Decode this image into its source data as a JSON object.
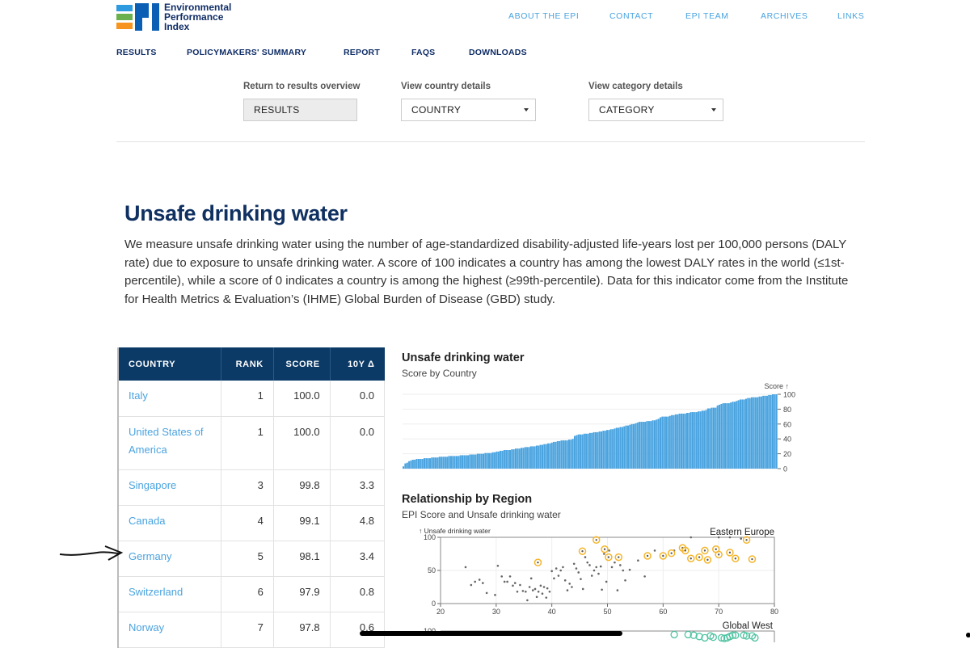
{
  "brand": {
    "line1": "Environmental",
    "line2": "Performance",
    "line3": "Index",
    "colors": {
      "blue_light": "#2e9be0",
      "green": "#6ab04c",
      "orange": "#f7941d",
      "blue_dark": "#0a5fb4"
    }
  },
  "topnav": [
    "ABOUT THE EPI",
    "CONTACT",
    "EPI TEAM",
    "ARCHIVES",
    "LINKS"
  ],
  "mainnav": [
    "RESULTS",
    "POLICYMAKERS' SUMMARY",
    "REPORT",
    "FAQS",
    "DOWNLOADS"
  ],
  "controls": {
    "results": {
      "label": "Return to results overview",
      "value": "RESULTS"
    },
    "country": {
      "label": "View country details",
      "value": "COUNTRY"
    },
    "category": {
      "label": "View category details",
      "value": "CATEGORY"
    }
  },
  "page": {
    "title": "Unsafe drinking water",
    "description": "We measure unsafe drinking water using the number of age-standardized disability-adjusted life-years lost per 100,000 persons (DALY rate) due to exposure to unsafe drinking water. A score of 100 indicates a country has among the lowest DALY rates in the world (≤1st-percentile), while a score of 0 indicates a country is among the highest (≥99th-percentile). Data for this indicator come from the Institute for Health Metrics & Evaluation’s (IHME) Global Burden of Disease (GBD) study."
  },
  "table": {
    "headers": [
      "COUNTRY",
      "RANK",
      "SCORE",
      "10Y Δ"
    ],
    "rows": [
      {
        "country": "Italy",
        "rank": "1",
        "score": "100.0",
        "delta": "0.0"
      },
      {
        "country": "United States of America",
        "rank": "1",
        "score": "100.0",
        "delta": "0.0"
      },
      {
        "country": "Singapore",
        "rank": "3",
        "score": "99.8",
        "delta": "3.3"
      },
      {
        "country": "Canada",
        "rank": "4",
        "score": "99.1",
        "delta": "4.8"
      },
      {
        "country": "Germany",
        "rank": "5",
        "score": "98.1",
        "delta": "3.4"
      },
      {
        "country": "Switzerland",
        "rank": "6",
        "score": "97.9",
        "delta": "0.8"
      },
      {
        "country": "Norway",
        "rank": "7",
        "score": "97.8",
        "delta": "0.6"
      }
    ]
  },
  "chart_data": [
    {
      "type": "bar",
      "title": "Unsafe drinking water",
      "subtitle": "Score by Country",
      "ylabel": "Score ↑",
      "ylim": [
        0,
        100
      ],
      "yticks": [
        0,
        20,
        40,
        60,
        80,
        100
      ],
      "grid": true,
      "color": "#4aa3df",
      "values": [
        3,
        7,
        8,
        10,
        11,
        12,
        12,
        13,
        13,
        13,
        13,
        14,
        14,
        14,
        14,
        15,
        15,
        15,
        15,
        16,
        16,
        16,
        16,
        16,
        17,
        17,
        17,
        17,
        17,
        17,
        18,
        18,
        18,
        18,
        18,
        19,
        19,
        19,
        19,
        20,
        20,
        20,
        20,
        21,
        21,
        21,
        21,
        22,
        22,
        23,
        23,
        24,
        24,
        25,
        25,
        25,
        25,
        26,
        26,
        27,
        27,
        27,
        28,
        28,
        29,
        29,
        29,
        30,
        30,
        30,
        31,
        31,
        32,
        32,
        33,
        33,
        34,
        34,
        35,
        36,
        36,
        37,
        37,
        38,
        38,
        38,
        38,
        39,
        39,
        40,
        44,
        45,
        46,
        46,
        46,
        47,
        47,
        47,
        48,
        48,
        49,
        49,
        49,
        50,
        50,
        51,
        51,
        52,
        52,
        53,
        53,
        54,
        55,
        55,
        56,
        56,
        57,
        58,
        58,
        59,
        60,
        60,
        61,
        62,
        63,
        63,
        63,
        63,
        64,
        64,
        64,
        65,
        65,
        66,
        67,
        69,
        70,
        70,
        70,
        70,
        71,
        72,
        72,
        73,
        73,
        74,
        74,
        74,
        74,
        75,
        75,
        76,
        76,
        76,
        76,
        77,
        77,
        78,
        78,
        79,
        81,
        81,
        82,
        82,
        82,
        85,
        86,
        87,
        88,
        88,
        88,
        88,
        89,
        90,
        90,
        91,
        92,
        93,
        93,
        93,
        94,
        95,
        95,
        96,
        96,
        96,
        96,
        97,
        97,
        98,
        98,
        98,
        99,
        99,
        100,
        100,
        100
      ]
    },
    {
      "type": "scatter",
      "title": "Relationship by Region",
      "subtitle": "EPI Score and Unsafe drinking water",
      "ylabel": "↑ Unsafe drinking water",
      "xlim": [
        20,
        80
      ],
      "ylim": [
        0,
        100
      ],
      "xticks": [
        20,
        30,
        40,
        50,
        60,
        70,
        80
      ],
      "yticks": [
        0,
        50,
        100
      ],
      "grid": true,
      "panels": [
        {
          "region": "Eastern Europe",
          "highlight_color": "#f5b52a",
          "highlighted": [
            [
              37.5,
              62
            ],
            [
              45.5,
              79
            ],
            [
              48,
              96
            ],
            [
              49.5,
              82
            ],
            [
              50.2,
              70
            ],
            [
              52,
              70
            ],
            [
              57.2,
              72
            ],
            [
              60,
              72
            ],
            [
              61.5,
              76
            ],
            [
              63.5,
              84
            ],
            [
              64,
              80
            ],
            [
              65,
              68
            ],
            [
              66.5,
              70
            ],
            [
              67.5,
              80
            ],
            [
              68,
              66
            ],
            [
              69.5,
              82
            ],
            [
              70,
              74
            ],
            [
              72,
              77
            ],
            [
              73,
              68
            ],
            [
              75,
              96
            ],
            [
              76,
              67
            ]
          ],
          "others": [
            [
              24.5,
              55
            ],
            [
              25.5,
              28
            ],
            [
              26.2,
              33
            ],
            [
              27,
              36
            ],
            [
              27.6,
              31
            ],
            [
              28.3,
              16
            ],
            [
              29.8,
              13
            ],
            [
              30.3,
              57
            ],
            [
              31,
              41
            ],
            [
              31.5,
              33
            ],
            [
              32,
              33
            ],
            [
              32.5,
              41
            ],
            [
              33,
              27
            ],
            [
              33.4,
              31
            ],
            [
              33.8,
              18
            ],
            [
              34.3,
              28
            ],
            [
              34.8,
              19
            ],
            [
              35.3,
              18
            ],
            [
              35.6,
              5
            ],
            [
              36,
              25
            ],
            [
              36.3,
              38
            ],
            [
              36.6,
              20
            ],
            [
              37,
              22
            ],
            [
              37.3,
              10
            ],
            [
              37.6,
              18
            ],
            [
              38,
              27
            ],
            [
              38.3,
              15
            ],
            [
              38.6,
              25
            ],
            [
              39,
              9
            ],
            [
              39.2,
              23
            ],
            [
              39.6,
              18
            ],
            [
              40,
              49
            ],
            [
              40.4,
              38
            ],
            [
              40.8,
              53
            ],
            [
              41.2,
              42
            ],
            [
              41.6,
              50
            ],
            [
              42,
              55
            ],
            [
              42.4,
              35
            ],
            [
              42.8,
              20
            ],
            [
              43.2,
              30
            ],
            [
              43.6,
              25
            ],
            [
              44,
              60
            ],
            [
              44.4,
              53
            ],
            [
              44.8,
              47
            ],
            [
              45.2,
              37
            ],
            [
              45.6,
              22
            ],
            [
              46,
              70
            ],
            [
              46.4,
              62
            ],
            [
              46.8,
              58
            ],
            [
              47.2,
              42
            ],
            [
              47.6,
              50
            ],
            [
              48,
              55
            ],
            [
              48.4,
              45
            ],
            [
              48.8,
              56
            ],
            [
              49,
              21
            ],
            [
              49.4,
              75
            ],
            [
              49.8,
              33
            ],
            [
              50.3,
              80
            ],
            [
              50.8,
              55
            ],
            [
              51.3,
              62
            ],
            [
              51.8,
              20
            ],
            [
              52.3,
              58
            ],
            [
              52.8,
              50
            ],
            [
              53.2,
              35
            ],
            [
              54,
              51
            ],
            [
              55.5,
              65
            ],
            [
              56.7,
              41
            ],
            [
              58.5,
              80
            ],
            [
              62,
              80
            ],
            [
              65,
              100
            ],
            [
              70,
              100
            ],
            [
              72,
              100
            ],
            [
              74,
              98
            ]
          ]
        },
        {
          "region": "Global West",
          "highlight_color": "#4fc3a1",
          "highlighted": [],
          "others": []
        }
      ]
    }
  ],
  "annotations": {
    "arrow_target": "Germany"
  }
}
